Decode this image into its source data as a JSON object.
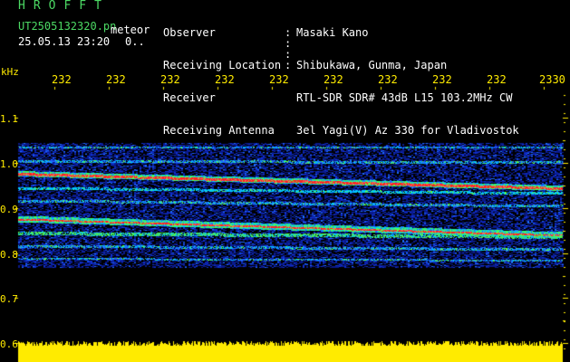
{
  "header": {
    "program": "HROFFT",
    "filename": "UT2505132320.pn",
    "meteor_label": "meteor",
    "datetime": "25.05.13 23:20",
    "counter": "0..",
    "info": [
      {
        "label": "Observer",
        "value": "Masaki Kano"
      },
      {
        "label": "Receiving Location",
        "value": "Shibukawa, Gunma, Japan"
      },
      {
        "label": "Receiver",
        "value": "RTL-SDR SDR# 43dB L15 103.2MHz CW"
      },
      {
        "label": "Receiving Antenna",
        "value": "3el Yagi(V) Az 330 for Vladivostok"
      }
    ]
  },
  "axes": {
    "y_unit": "kHz",
    "y_ticks": [
      "1.1",
      "1.0",
      "0.9",
      "0.8",
      "0.7",
      "0.6"
    ],
    "x_ticks": [
      "232",
      "232",
      "232",
      "232",
      "232",
      "232",
      "232",
      "232",
      "232",
      "2330"
    ]
  },
  "colors": {
    "background": "#000000",
    "header_text": "#ffffff",
    "program_text": "#4cd964",
    "axis_text": "#ffeb00",
    "signal_low": "#0a1eaa",
    "signal_mid": "#00c8ff",
    "signal_high": "#60ff40",
    "signal_peak": "#ff2020",
    "amplitude_bar": "#ffeb00"
  }
}
